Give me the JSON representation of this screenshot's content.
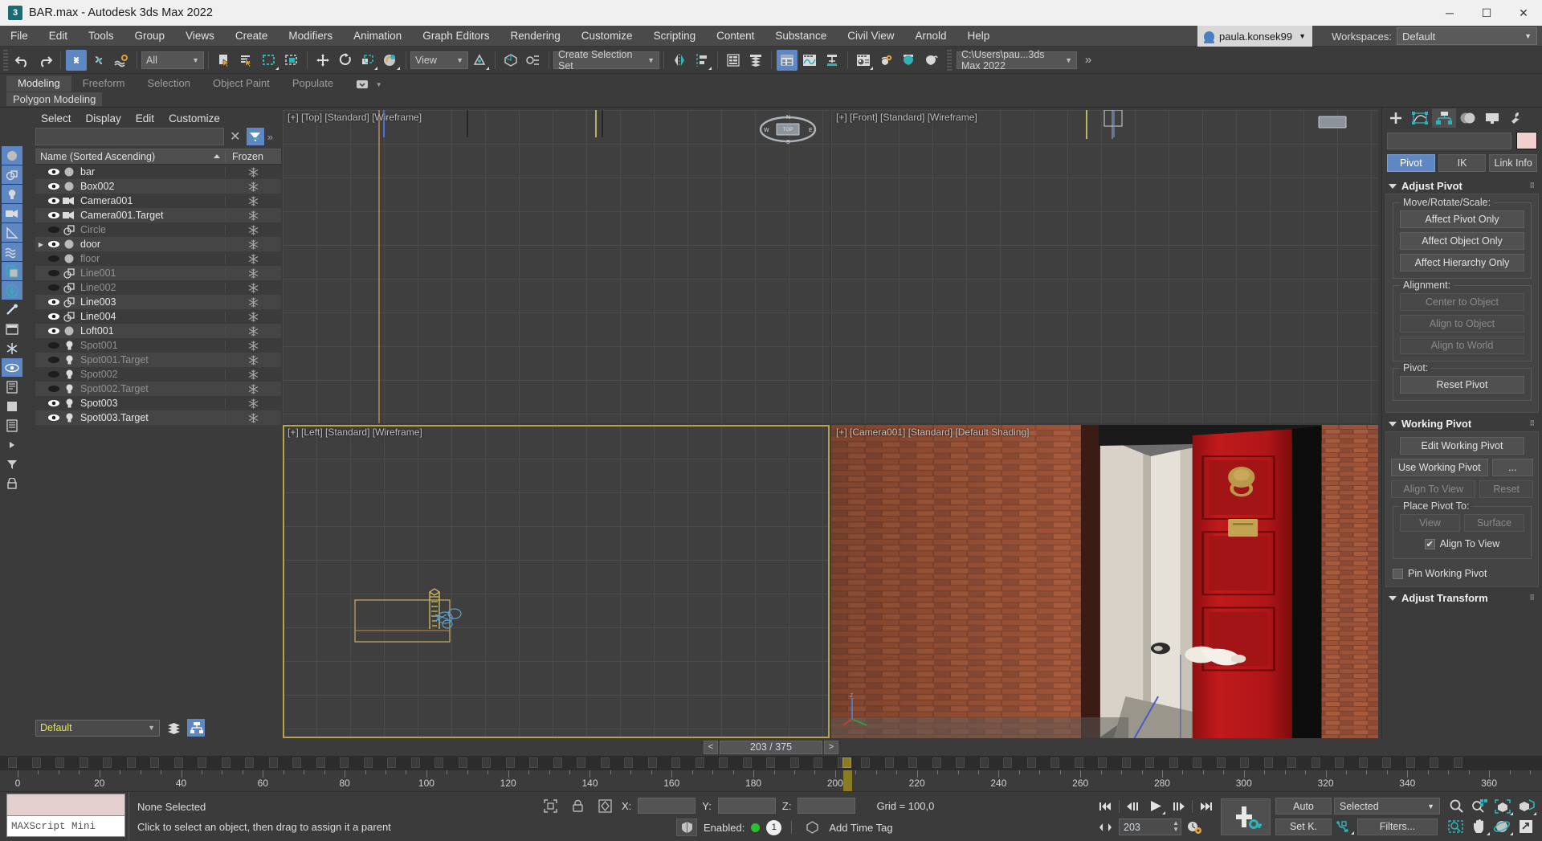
{
  "titlebar": {
    "title": "BAR.max - Autodesk 3ds Max 2022",
    "app_icon": "max-logo-icon",
    "minimize": "─",
    "maximize": "☐",
    "close": "✕"
  },
  "menubar": {
    "items": [
      "File",
      "Edit",
      "Tools",
      "Group",
      "Views",
      "Create",
      "Modifiers",
      "Animation",
      "Graph Editors",
      "Rendering",
      "Customize",
      "Scripting",
      "Content",
      "Substance",
      "Civil View",
      "Arnold",
      "Help"
    ],
    "account": "paula.konsek99",
    "workspaces_label": "Workspaces:",
    "workspace_value": "Default"
  },
  "toolbar": {
    "undo": "undo-icon",
    "redo": "redo-icon",
    "select_and_link": "select-and-link-icon",
    "unlink": "unlink-selection-icon",
    "bind_space_warp": "bind-to-space-warp-icon",
    "filter_value": "All",
    "select_object": "select-object-icon",
    "select_by_name": "select-by-name-icon",
    "rect_region": "rectangular-selection-region-icon",
    "window_crossing": "window-crossing-icon",
    "select_move": "select-and-move-icon",
    "select_rotate": "select-and-rotate-icon",
    "select_scale": "select-and-scale-icon",
    "select_place": "select-and-place-icon",
    "ref_coord_value": "View",
    "use_center": "use-pivot-point-center-icon",
    "selection_set_placeholder": "Create Selection Set",
    "mirror": "mirror-icon",
    "align": "align-icon",
    "layer_explorer": "layer-explorer-icon",
    "scene_explorer": "scene-explorer-icon",
    "render_setup": "render-setup-icon",
    "curve_editor": "curve-editor-icon",
    "schematic_view": "schematic-view-icon",
    "material_editor": "material-editor-icon",
    "render_production": "render-production-icon",
    "render_iterative": "render-iterative-icon",
    "render_active_shade": "active-shade-icon",
    "project_path": "C:\\Users\\pau...3ds Max 2022"
  },
  "ribbon": {
    "tabs": [
      "Modeling",
      "Freeform",
      "Selection",
      "Object Paint",
      "Populate"
    ],
    "active_tab": "Modeling",
    "panel": "Polygon Modeling"
  },
  "explorer": {
    "menus": [
      "Select",
      "Display",
      "Edit",
      "Customize"
    ],
    "search_value": "",
    "clear_icon": "clear-x-icon",
    "filter_icon": "filter-funnel-icon",
    "overflow": "»",
    "columns": [
      "Name (Sorted Ascending)",
      "Frozen"
    ],
    "rows": [
      {
        "name": "bar",
        "type": "geometry",
        "visible": true,
        "dim": false,
        "frozen_icon": "snowflake-icon",
        "expandable": false
      },
      {
        "name": "Box002",
        "type": "geometry",
        "visible": true,
        "dim": false,
        "frozen_icon": "snowflake-icon",
        "expandable": false
      },
      {
        "name": "Camera001",
        "type": "camera",
        "visible": true,
        "dim": false,
        "frozen_icon": "snowflake-icon",
        "expandable": false
      },
      {
        "name": "Camera001.Target",
        "type": "camera",
        "visible": true,
        "dim": false,
        "frozen_icon": "snowflake-icon",
        "expandable": false
      },
      {
        "name": "Circle",
        "type": "shape",
        "visible": false,
        "dim": true,
        "frozen_icon": "snowflake-icon",
        "expandable": false
      },
      {
        "name": "door",
        "type": "geometry",
        "visible": true,
        "dim": false,
        "frozen_icon": "snowflake-icon",
        "expandable": true
      },
      {
        "name": "floor",
        "type": "geometry",
        "visible": false,
        "dim": true,
        "frozen_icon": "snowflake-icon",
        "expandable": false
      },
      {
        "name": "Line001",
        "type": "shape",
        "visible": false,
        "dim": true,
        "frozen_icon": "snowflake-icon",
        "expandable": false
      },
      {
        "name": "Line002",
        "type": "shape",
        "visible": false,
        "dim": true,
        "frozen_icon": "snowflake-icon",
        "expandable": false
      },
      {
        "name": "Line003",
        "type": "shape",
        "visible": true,
        "dim": false,
        "frozen_icon": "snowflake-icon",
        "expandable": false
      },
      {
        "name": "Line004",
        "type": "shape",
        "visible": true,
        "dim": false,
        "frozen_icon": "snowflake-icon",
        "expandable": false
      },
      {
        "name": "Loft001",
        "type": "geometry",
        "visible": true,
        "dim": false,
        "frozen_icon": "snowflake-icon",
        "expandable": false
      },
      {
        "name": "Spot001",
        "type": "light",
        "visible": false,
        "dim": true,
        "frozen_icon": "snowflake-icon",
        "expandable": false
      },
      {
        "name": "Spot001.Target",
        "type": "light",
        "visible": false,
        "dim": true,
        "frozen_icon": "snowflake-icon",
        "expandable": false
      },
      {
        "name": "Spot002",
        "type": "light",
        "visible": false,
        "dim": true,
        "frozen_icon": "snowflake-icon",
        "expandable": false
      },
      {
        "name": "Spot002.Target",
        "type": "light",
        "visible": false,
        "dim": true,
        "frozen_icon": "snowflake-icon",
        "expandable": false
      },
      {
        "name": "Spot003",
        "type": "light",
        "visible": true,
        "dim": false,
        "frozen_icon": "snowflake-icon",
        "expandable": false
      },
      {
        "name": "Spot003.Target",
        "type": "light",
        "visible": true,
        "dim": false,
        "frozen_icon": "snowflake-icon",
        "expandable": false
      }
    ],
    "layer_value": "Default",
    "layer_explorer_icon": "layers-icon",
    "scene_explorer_icon": "hierarchy-icon"
  },
  "viewports": [
    {
      "label": "[+] [Top] [Standard] [Wireframe]",
      "active": false,
      "kind": "wireframe"
    },
    {
      "label": "[+] [Front] [Standard] [Wireframe]",
      "active": false,
      "kind": "wireframe"
    },
    {
      "label": "[+] [Left] [Standard] [Wireframe]",
      "active": true,
      "kind": "wireframe"
    },
    {
      "label": "[+] [Camera001] [Standard] [Default Shading]",
      "active": false,
      "kind": "camera"
    }
  ],
  "command_panel": {
    "tabs": [
      "create-tab",
      "modify-tab",
      "hierarchy-tab",
      "motion-tab",
      "display-tab",
      "utilities-tab"
    ],
    "active_tab_index": 2,
    "object_name": "",
    "color_swatch": "#f2cfcf",
    "mode_buttons": [
      "Pivot",
      "IK",
      "Link Info"
    ],
    "active_mode": "Pivot",
    "rollouts": [
      {
        "title": "Adjust Pivot",
        "groups": [
          {
            "label": "Move/Rotate/Scale:",
            "buttons": [
              {
                "text": "Affect Pivot Only",
                "disabled": false
              },
              {
                "text": "Affect Object Only",
                "disabled": false
              },
              {
                "text": "Affect Hierarchy Only",
                "disabled": false
              }
            ]
          },
          {
            "label": "Alignment:",
            "buttons": [
              {
                "text": "Center to Object",
                "disabled": true
              },
              {
                "text": "Align to Object",
                "disabled": true
              },
              {
                "text": "Align to World",
                "disabled": true
              }
            ]
          },
          {
            "label": "Pivot:",
            "buttons": [
              {
                "text": "Reset Pivot",
                "disabled": false
              }
            ]
          }
        ]
      },
      {
        "title": "Working Pivot",
        "buttons_full": [
          "Edit Working Pivot"
        ],
        "row1": [
          {
            "text": "Use Working Pivot",
            "disabled": false
          },
          {
            "text": "...",
            "disabled": false
          }
        ],
        "row2": [
          {
            "text": "Align To View",
            "disabled": true
          },
          {
            "text": "Reset",
            "disabled": true
          }
        ],
        "place_group_label": "Place Pivot To:",
        "place_row": [
          {
            "text": "View",
            "disabled": true
          },
          {
            "text": "Surface",
            "disabled": true
          }
        ],
        "align_checkbox": {
          "label": "Align To View",
          "checked": true
        },
        "pin_checkbox": {
          "label": "Pin Working Pivot",
          "checked": false
        }
      },
      {
        "title": "Adjust Transform"
      }
    ]
  },
  "timeline": {
    "prev_icon": "<",
    "next_icon": ">",
    "frame_display": "203 / 375",
    "current_frame": 203,
    "total_frames": 375,
    "ruler_labels": [
      0,
      20,
      40,
      60,
      80,
      100,
      120,
      140,
      160,
      180,
      200,
      220,
      240,
      260,
      280,
      300,
      320,
      340,
      360
    ]
  },
  "status": {
    "maxscript_label": "MAXScript Mini",
    "selection_status": "None Selected",
    "prompt": "Click to select an object, then drag to assign it a parent",
    "x_label": "X:",
    "x_value": "",
    "y_label": "Y:",
    "y_value": "",
    "z_label": "Z:",
    "z_value": "",
    "grid_text": "Grid = 100,0",
    "enabled_label": "Enabled:",
    "enabled_badge": "1",
    "add_time_tag": "Add Time Tag",
    "isolate_icon": "isolate-selection-icon",
    "lock_icon": "selection-lock-icon",
    "abs_rel_icon": "absolute-relative-icon",
    "adaptive_degr_icon": "adaptive-degradation-icon",
    "time_tag_icon": "time-tag-icon"
  },
  "animation": {
    "go_start": "go-to-start-icon",
    "prev_frame": "previous-frame-icon",
    "play": "play-animation-icon",
    "next_frame": "next-frame-icon",
    "go_end": "go-to-end-icon",
    "current_frame_value": "203",
    "time_config_icon": "time-configuration-icon",
    "set_key_icon": "set-key-button-icon",
    "auto_key": "Auto",
    "set_key": "Set K.",
    "key_filter_selected": "Selected",
    "key_mode_icon": "key-mode-toggle-icon",
    "filters": "Filters...",
    "nav": {
      "zoom": "zoom-icon",
      "zoom_all": "zoom-all-icon",
      "zoom_extents": "zoom-extents-icon",
      "zoom_extents_all": "zoom-extents-all-icon",
      "zoom_region": "zoom-region-icon",
      "pan": "pan-view-icon",
      "orbit": "orbit-icon",
      "maximize_viewport": "maximize-viewport-toggle-icon"
    }
  }
}
